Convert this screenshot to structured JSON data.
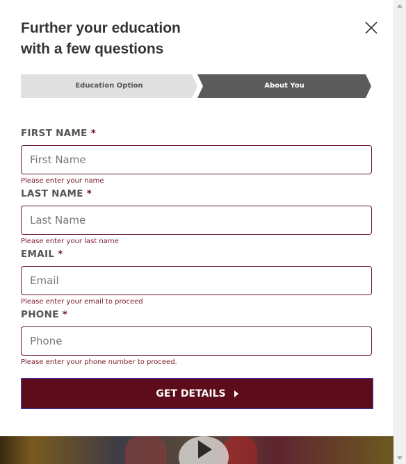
{
  "modal": {
    "title_line1": "Further your education",
    "title_line2": "with a few questions",
    "close_icon": "close-icon"
  },
  "steps": [
    {
      "label": "Education Option",
      "active": false
    },
    {
      "label": "About You",
      "active": true
    }
  ],
  "form": {
    "first_name": {
      "label": "FIRST NAME",
      "required": "*",
      "placeholder": "First Name",
      "value": "",
      "error": "Please enter your name"
    },
    "last_name": {
      "label": "LAST NAME",
      "required": "*",
      "placeholder": "Last Name",
      "value": "",
      "error": "Please enter your last name"
    },
    "email": {
      "label": "EMAIL",
      "required": "*",
      "placeholder": "Email",
      "value": "",
      "error": "Please enter your email to proceed"
    },
    "phone": {
      "label": "PHONE",
      "required": "*",
      "placeholder": "Phone",
      "value": "",
      "error": "Please enter your phone number to proceed."
    },
    "submit_label": "GET DETAILS",
    "submit_icon": "caret-right-icon"
  },
  "colors": {
    "accent": "#5c0c1a",
    "error": "#7a1a2a",
    "step_inactive": "#e0e0e0",
    "step_active": "#5b5b5b"
  }
}
